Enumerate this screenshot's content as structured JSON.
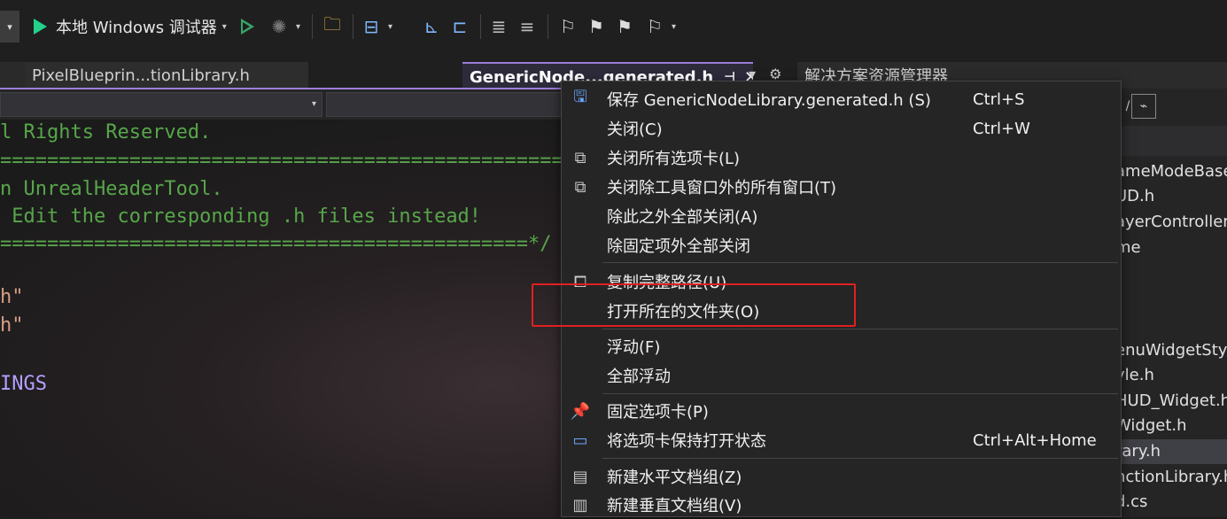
{
  "toolbar": {
    "run_label": "本地 Windows 调试器"
  },
  "tabs": {
    "pixel_tab": "PixelBlueprin...tionLibrary.h",
    "active_tab": "GenericNode...generated.h",
    "solution_explorer": "解决方案资源管理器"
  },
  "code": {
    "line1": "l Rights Reserved.",
    "line2": "==================================================",
    "line3": "n UnrealHeaderTool.",
    "line4": " Edit the corresponding .h files instead!",
    "line5": "=============================================*/",
    "line6": "h\"",
    "line7": "h\"",
    "line8": "INGS"
  },
  "solution": {
    "items": [
      "ameModeBase",
      "UD.h",
      "ayerController",
      "me",
      "enuWidgetSty",
      "yle.h",
      "HUD_Widget.h",
      "Widget.h",
      "rary.h",
      "nctionLibrary.h",
      "d.cs"
    ]
  },
  "menu": {
    "items": [
      {
        "label": "保存 GenericNodeLibrary.generated.h (S)",
        "shortcut": "Ctrl+S",
        "icon": "save-icon"
      },
      {
        "label": "关闭(C)",
        "shortcut": "Ctrl+W",
        "icon": ""
      },
      {
        "label": "关闭所有选项卡(L)",
        "shortcut": "",
        "icon": "close-all-tabs-icon"
      },
      {
        "label": "关闭除工具窗口外的所有窗口(T)",
        "shortcut": "",
        "icon": "close-windows-icon"
      },
      {
        "label": "除此之外全部关闭(A)",
        "shortcut": "",
        "icon": ""
      },
      {
        "label": "除固定项外全部关闭",
        "shortcut": "",
        "icon": ""
      },
      {
        "label": "复制完整路径(U)",
        "shortcut": "",
        "icon": "copy-icon"
      },
      {
        "label": "打开所在的文件夹(O)",
        "shortcut": "",
        "icon": ""
      },
      {
        "label": "浮动(F)",
        "shortcut": "",
        "icon": ""
      },
      {
        "label": "全部浮动",
        "shortcut": "",
        "icon": ""
      },
      {
        "label": "固定选项卡(P)",
        "shortcut": "",
        "icon": "pin-icon"
      },
      {
        "label": "将选项卡保持打开状态",
        "shortcut": "Ctrl+Alt+Home",
        "icon": "keep-open-icon"
      },
      {
        "label": "新建水平文档组(Z)",
        "shortcut": "",
        "icon": "horizontal-group-icon"
      },
      {
        "label": "新建垂直文档组(V)",
        "shortcut": "",
        "icon": "vertical-group-icon"
      }
    ]
  },
  "colors": {
    "accent": "#9d7cd8",
    "highlight_box": "#e02020",
    "comment_green": "#57a64a"
  }
}
